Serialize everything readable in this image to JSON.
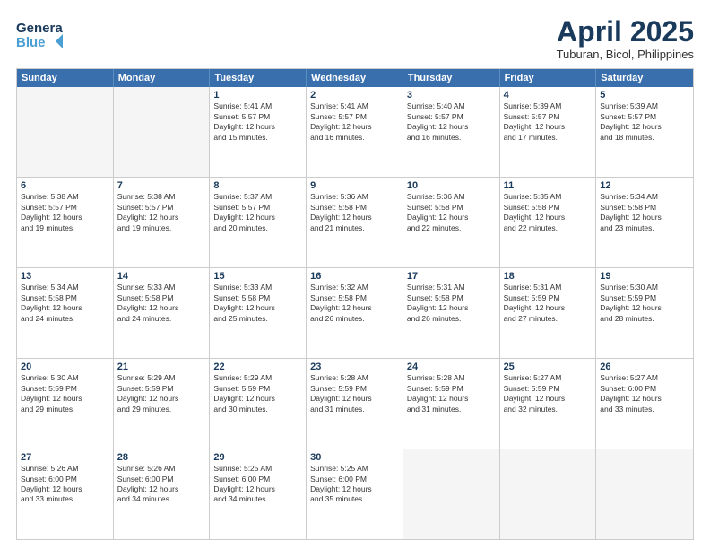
{
  "logo": {
    "line1": "General",
    "line2": "Blue"
  },
  "title": "April 2025",
  "subtitle": "Tuburan, Bicol, Philippines",
  "days": [
    "Sunday",
    "Monday",
    "Tuesday",
    "Wednesday",
    "Thursday",
    "Friday",
    "Saturday"
  ],
  "rows": [
    [
      {
        "num": "",
        "info": "",
        "empty": true
      },
      {
        "num": "",
        "info": "",
        "empty": true
      },
      {
        "num": "1",
        "info": "Sunrise: 5:41 AM\nSunset: 5:57 PM\nDaylight: 12 hours\nand 15 minutes."
      },
      {
        "num": "2",
        "info": "Sunrise: 5:41 AM\nSunset: 5:57 PM\nDaylight: 12 hours\nand 16 minutes."
      },
      {
        "num": "3",
        "info": "Sunrise: 5:40 AM\nSunset: 5:57 PM\nDaylight: 12 hours\nand 16 minutes."
      },
      {
        "num": "4",
        "info": "Sunrise: 5:39 AM\nSunset: 5:57 PM\nDaylight: 12 hours\nand 17 minutes."
      },
      {
        "num": "5",
        "info": "Sunrise: 5:39 AM\nSunset: 5:57 PM\nDaylight: 12 hours\nand 18 minutes."
      }
    ],
    [
      {
        "num": "6",
        "info": "Sunrise: 5:38 AM\nSunset: 5:57 PM\nDaylight: 12 hours\nand 19 minutes."
      },
      {
        "num": "7",
        "info": "Sunrise: 5:38 AM\nSunset: 5:57 PM\nDaylight: 12 hours\nand 19 minutes."
      },
      {
        "num": "8",
        "info": "Sunrise: 5:37 AM\nSunset: 5:57 PM\nDaylight: 12 hours\nand 20 minutes."
      },
      {
        "num": "9",
        "info": "Sunrise: 5:36 AM\nSunset: 5:58 PM\nDaylight: 12 hours\nand 21 minutes."
      },
      {
        "num": "10",
        "info": "Sunrise: 5:36 AM\nSunset: 5:58 PM\nDaylight: 12 hours\nand 22 minutes."
      },
      {
        "num": "11",
        "info": "Sunrise: 5:35 AM\nSunset: 5:58 PM\nDaylight: 12 hours\nand 22 minutes."
      },
      {
        "num": "12",
        "info": "Sunrise: 5:34 AM\nSunset: 5:58 PM\nDaylight: 12 hours\nand 23 minutes."
      }
    ],
    [
      {
        "num": "13",
        "info": "Sunrise: 5:34 AM\nSunset: 5:58 PM\nDaylight: 12 hours\nand 24 minutes."
      },
      {
        "num": "14",
        "info": "Sunrise: 5:33 AM\nSunset: 5:58 PM\nDaylight: 12 hours\nand 24 minutes."
      },
      {
        "num": "15",
        "info": "Sunrise: 5:33 AM\nSunset: 5:58 PM\nDaylight: 12 hours\nand 25 minutes."
      },
      {
        "num": "16",
        "info": "Sunrise: 5:32 AM\nSunset: 5:58 PM\nDaylight: 12 hours\nand 26 minutes."
      },
      {
        "num": "17",
        "info": "Sunrise: 5:31 AM\nSunset: 5:58 PM\nDaylight: 12 hours\nand 26 minutes."
      },
      {
        "num": "18",
        "info": "Sunrise: 5:31 AM\nSunset: 5:59 PM\nDaylight: 12 hours\nand 27 minutes."
      },
      {
        "num": "19",
        "info": "Sunrise: 5:30 AM\nSunset: 5:59 PM\nDaylight: 12 hours\nand 28 minutes."
      }
    ],
    [
      {
        "num": "20",
        "info": "Sunrise: 5:30 AM\nSunset: 5:59 PM\nDaylight: 12 hours\nand 29 minutes."
      },
      {
        "num": "21",
        "info": "Sunrise: 5:29 AM\nSunset: 5:59 PM\nDaylight: 12 hours\nand 29 minutes."
      },
      {
        "num": "22",
        "info": "Sunrise: 5:29 AM\nSunset: 5:59 PM\nDaylight: 12 hours\nand 30 minutes."
      },
      {
        "num": "23",
        "info": "Sunrise: 5:28 AM\nSunset: 5:59 PM\nDaylight: 12 hours\nand 31 minutes."
      },
      {
        "num": "24",
        "info": "Sunrise: 5:28 AM\nSunset: 5:59 PM\nDaylight: 12 hours\nand 31 minutes."
      },
      {
        "num": "25",
        "info": "Sunrise: 5:27 AM\nSunset: 5:59 PM\nDaylight: 12 hours\nand 32 minutes."
      },
      {
        "num": "26",
        "info": "Sunrise: 5:27 AM\nSunset: 6:00 PM\nDaylight: 12 hours\nand 33 minutes."
      }
    ],
    [
      {
        "num": "27",
        "info": "Sunrise: 5:26 AM\nSunset: 6:00 PM\nDaylight: 12 hours\nand 33 minutes."
      },
      {
        "num": "28",
        "info": "Sunrise: 5:26 AM\nSunset: 6:00 PM\nDaylight: 12 hours\nand 34 minutes."
      },
      {
        "num": "29",
        "info": "Sunrise: 5:25 AM\nSunset: 6:00 PM\nDaylight: 12 hours\nand 34 minutes."
      },
      {
        "num": "30",
        "info": "Sunrise: 5:25 AM\nSunset: 6:00 PM\nDaylight: 12 hours\nand 35 minutes."
      },
      {
        "num": "",
        "info": "",
        "empty": true
      },
      {
        "num": "",
        "info": "",
        "empty": true
      },
      {
        "num": "",
        "info": "",
        "empty": true
      }
    ]
  ]
}
